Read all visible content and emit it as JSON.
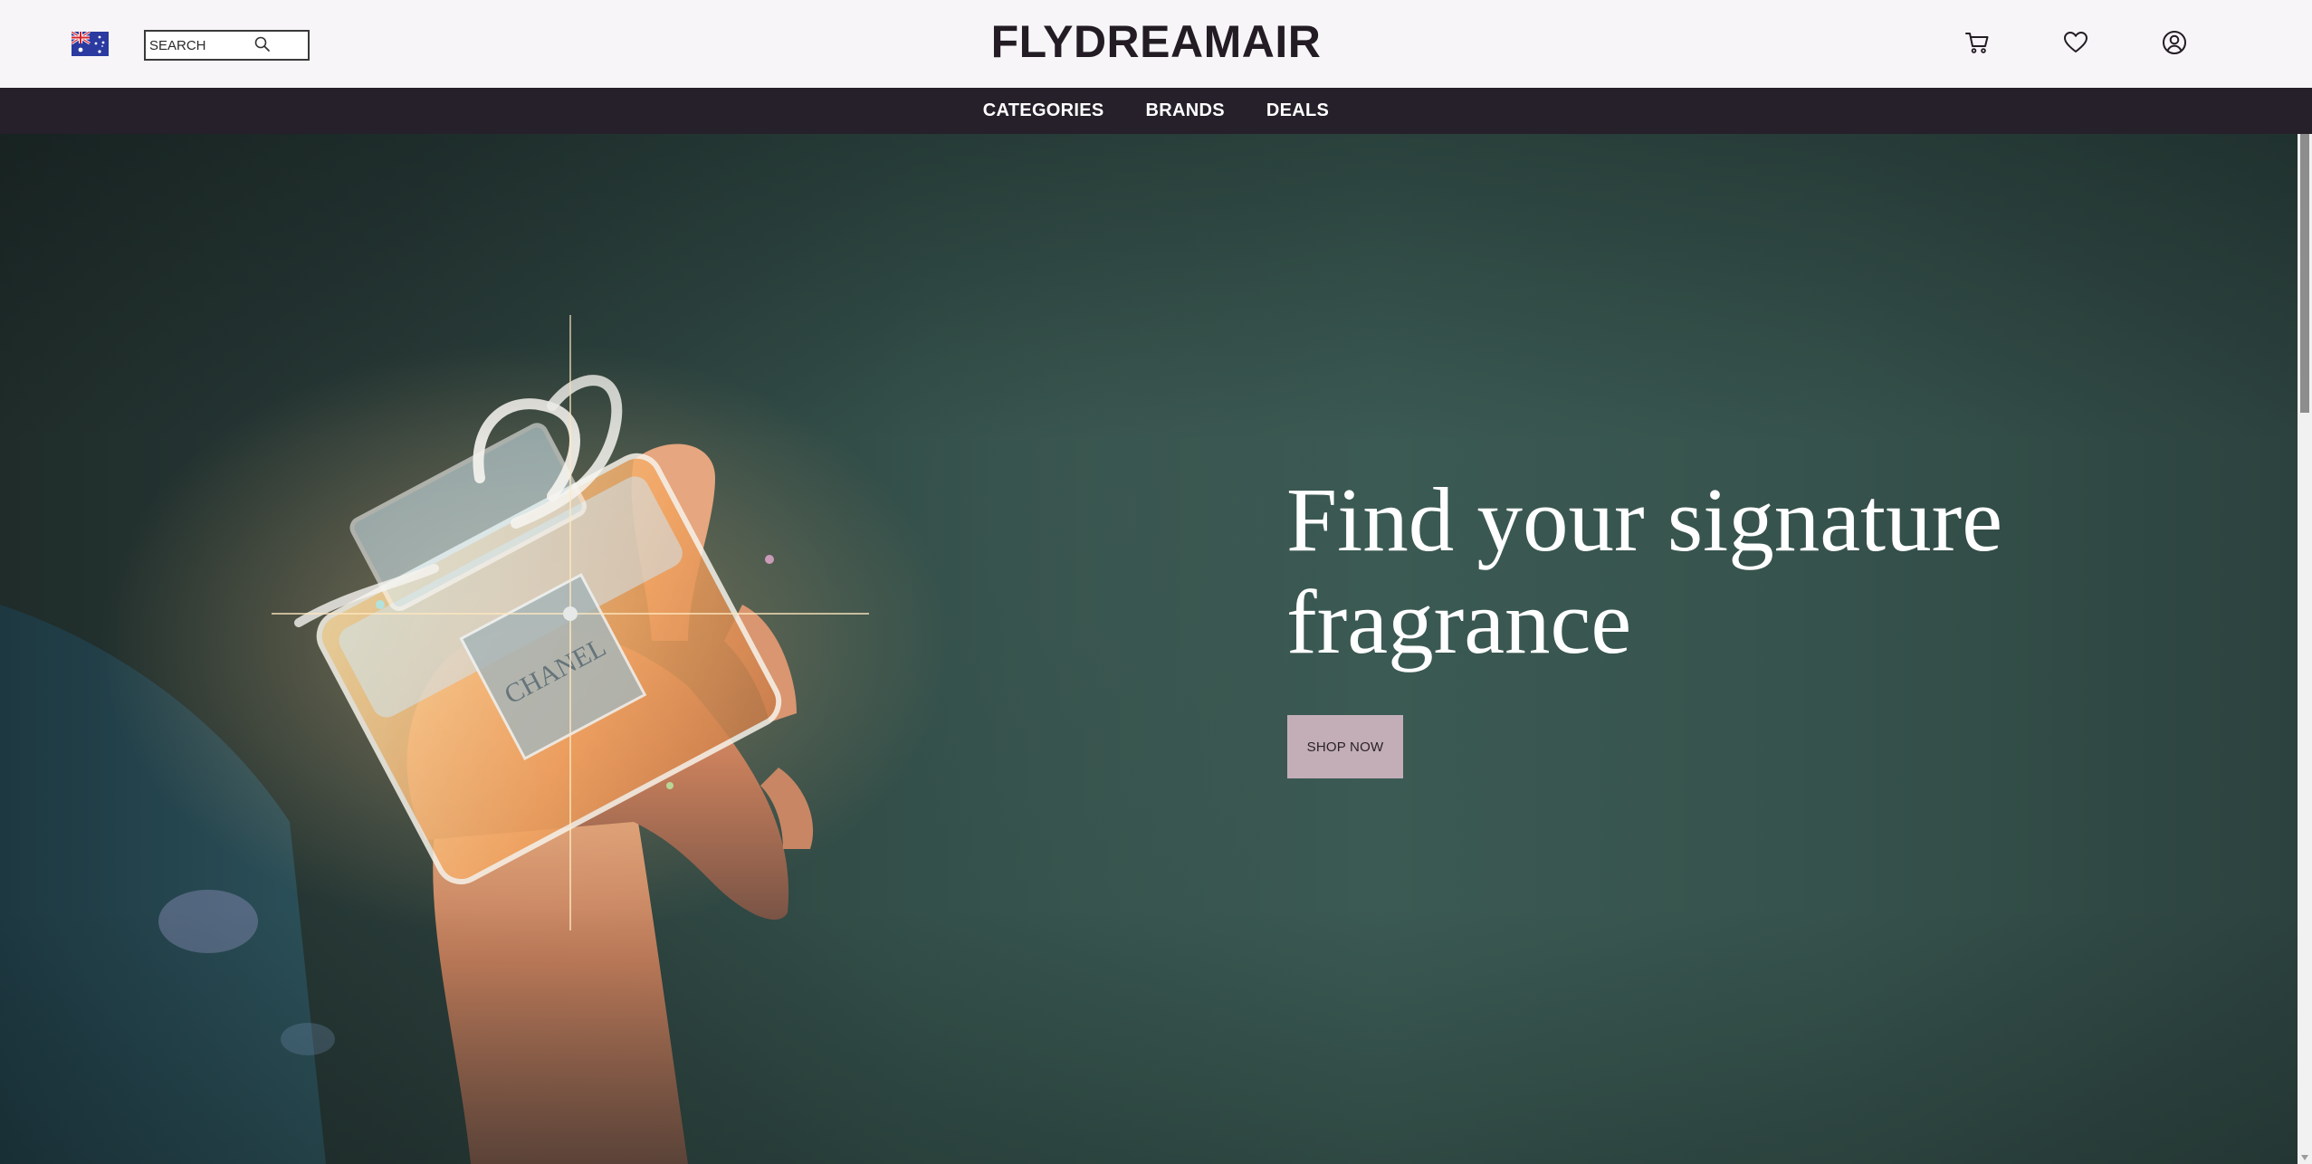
{
  "header": {
    "region_flag": "australia-flag",
    "search": {
      "placeholder": "SEARCH",
      "value": ""
    },
    "logo": "FLYDREAMAIR",
    "icons": [
      "cart-icon",
      "heart-icon",
      "user-icon"
    ]
  },
  "nav": {
    "items": [
      {
        "label": "CATEGORIES"
      },
      {
        "label": "BRANDS"
      },
      {
        "label": "DEALS"
      }
    ]
  },
  "hero": {
    "heading": "Find your signature fragrance",
    "cta_label": "SHOP NOW",
    "image": "hand-holding-perfume-bottle-image"
  },
  "colors": {
    "header_bg": "#f7f5f8",
    "nav_bg": "#26202a",
    "hero_bg": "#3b5a53",
    "cta_bg": "#c3aeb8",
    "logo_text": "#231c24"
  }
}
